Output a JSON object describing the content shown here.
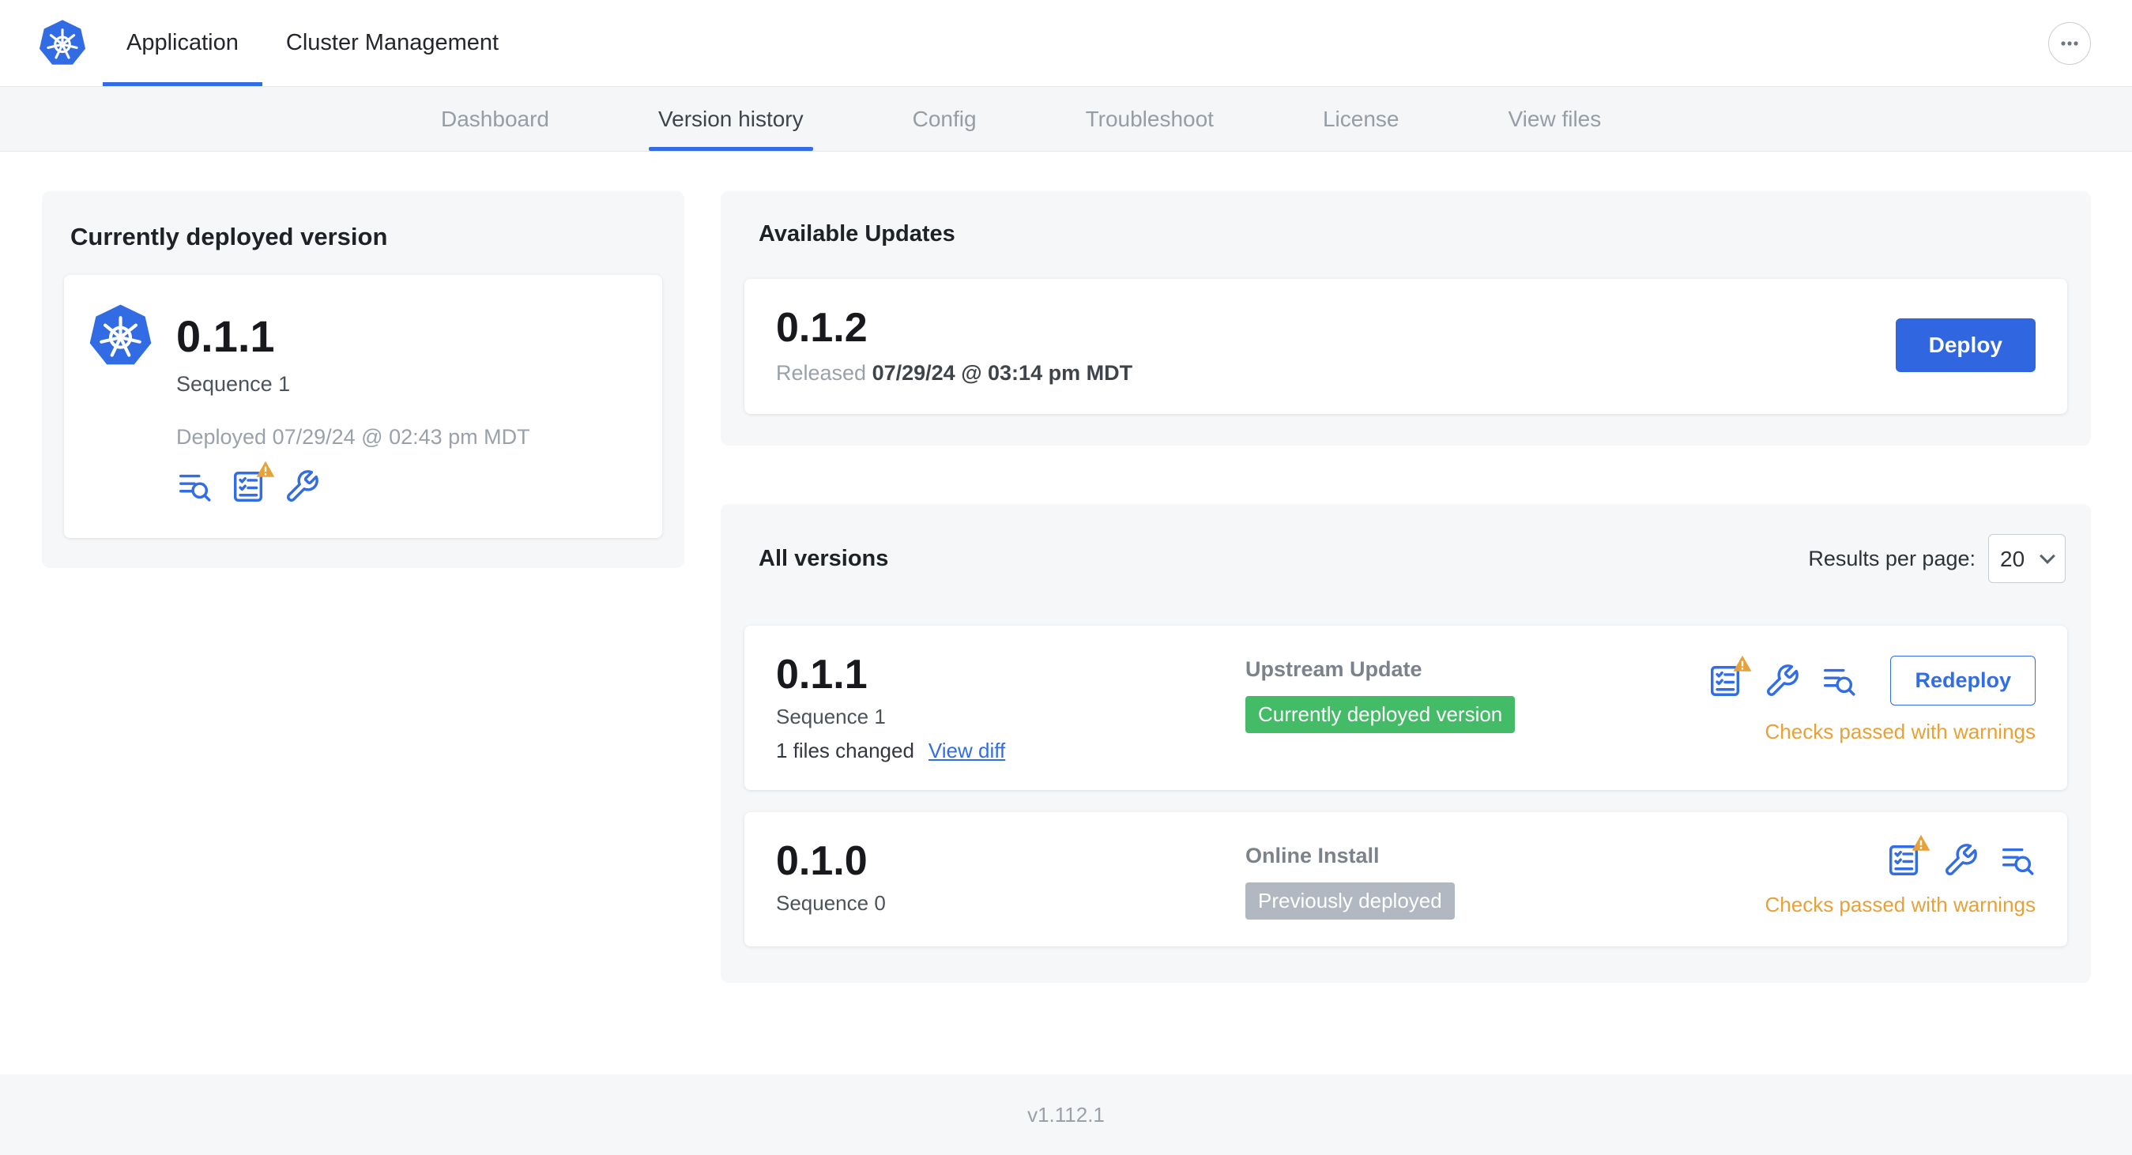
{
  "topbar": {
    "tabs": [
      {
        "label": "Application"
      },
      {
        "label": "Cluster Management"
      }
    ]
  },
  "subnav": {
    "items": [
      {
        "label": "Dashboard"
      },
      {
        "label": "Version history"
      },
      {
        "label": "Config"
      },
      {
        "label": "Troubleshoot"
      },
      {
        "label": "License"
      },
      {
        "label": "View files"
      }
    ]
  },
  "current_version": {
    "title": "Currently deployed version",
    "version": "0.1.1",
    "sequence": "Sequence 1",
    "deployed": "Deployed 07/29/24 @ 02:43 pm MDT"
  },
  "available_updates": {
    "title": "Available Updates",
    "version": "0.1.2",
    "released_prefix": "Released",
    "released_date": "07/29/24 @ 03:14 pm MDT",
    "deploy_label": "Deploy"
  },
  "all_versions": {
    "title": "All versions",
    "results_per_page_label": "Results per page:",
    "results_per_page_value": "20",
    "rows": [
      {
        "version": "0.1.1",
        "sequence": "Sequence 1",
        "files_changed": "1 files changed",
        "view_diff_label": "View diff",
        "source": "Upstream Update",
        "badge": "Currently deployed version",
        "badge_color": "green",
        "action_label": "Redeploy",
        "status": "Checks passed with warnings"
      },
      {
        "version": "0.1.0",
        "sequence": "Sequence 0",
        "source": "Online Install",
        "badge": "Previously deployed",
        "badge_color": "gray",
        "status": "Checks passed with warnings"
      }
    ]
  },
  "footer": {
    "version": "v1.112.1"
  },
  "colors": {
    "accent": "#326de6",
    "deploy_button": "#3066e0",
    "badge_green": "#44bb66",
    "badge_gray": "#b2b8c1",
    "warning": "#e7a139"
  }
}
